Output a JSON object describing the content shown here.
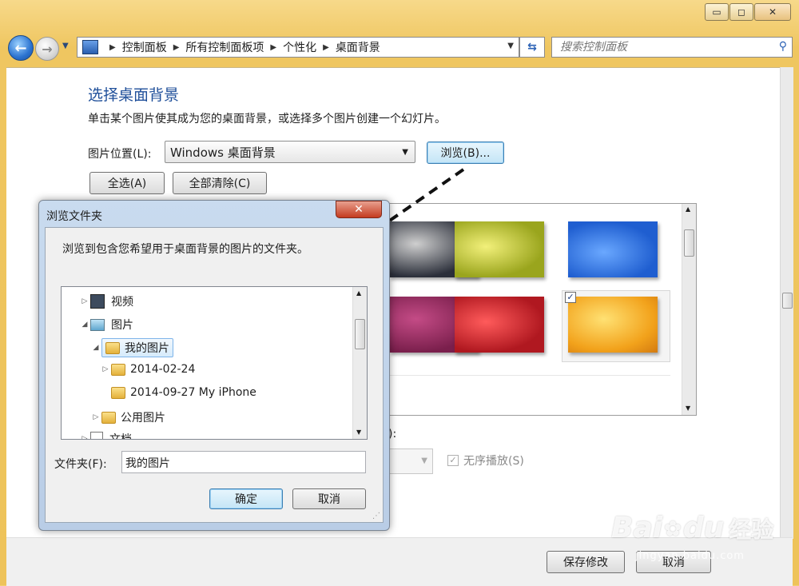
{
  "window": {
    "minimize_symbol": "▭",
    "maximize_symbol": "◻",
    "close_symbol": "✕"
  },
  "nav": {
    "breadcrumbs": [
      "控制面板",
      "所有控制面板项",
      "个性化",
      "桌面背景"
    ],
    "search_placeholder": "搜索控制面板"
  },
  "main": {
    "title": "选择桌面背景",
    "subtitle": "单击某个图片使其成为您的桌面背景，或选择多个图片创建一个幻灯片。",
    "location_label": "图片位置(L):",
    "location_value": "Windows 桌面背景",
    "browse_button": "浏览(B)...",
    "select_all_button": "全选(A)",
    "clear_all_button": "全部清除(C)",
    "partial_label": "):",
    "shuffle_label": "无序播放(S)",
    "save_button": "保存修改",
    "cancel_button": "取消",
    "thumbnails": [
      {
        "color": "#2b2f3a"
      },
      {
        "color": "#9aa51d"
      },
      {
        "color": "#1f5ed0"
      },
      {
        "color": "#7a1f4c"
      },
      {
        "color": "#b01820"
      },
      {
        "color": "#f2a21b",
        "checked": true
      }
    ]
  },
  "dialog": {
    "title": "浏览文件夹",
    "close_symbol": "✕",
    "description": "浏览到包含您希望用于桌面背景的图片的文件夹。",
    "tree": [
      {
        "label": "视频"
      },
      {
        "label": "图片"
      },
      {
        "label": "我的图片"
      },
      {
        "label": "2014-02-24"
      },
      {
        "label": "2014-09-27 My iPhone"
      },
      {
        "label": "公用图片"
      },
      {
        "label": "文档"
      }
    ],
    "folder_label": "文件夹(F):",
    "folder_value": "我的图片",
    "ok_button": "确定",
    "cancel_button": "取消"
  },
  "watermark": {
    "brand": "Bai",
    "brand_suffix": "du",
    "cn": "经验",
    "url": "jingyan.baidu.com"
  }
}
